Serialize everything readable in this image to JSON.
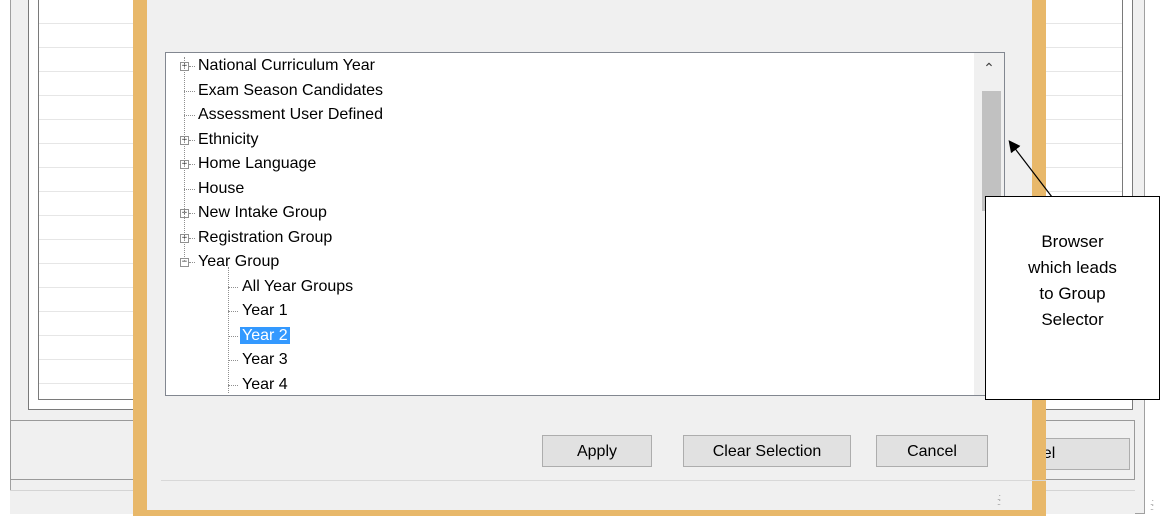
{
  "tree": {
    "nodes": [
      {
        "label": "National Curriculum Year",
        "expandable": true,
        "expanded": false,
        "level": 0
      },
      {
        "label": "Exam Season Candidates",
        "expandable": false,
        "level": 0
      },
      {
        "label": "Assessment User Defined",
        "expandable": false,
        "level": 0
      },
      {
        "label": "Ethnicity",
        "expandable": true,
        "expanded": false,
        "level": 0
      },
      {
        "label": "Home Language",
        "expandable": true,
        "expanded": false,
        "level": 0
      },
      {
        "label": "House",
        "expandable": false,
        "level": 0
      },
      {
        "label": "New Intake Group",
        "expandable": true,
        "expanded": false,
        "level": 0
      },
      {
        "label": "Registration Group",
        "expandable": true,
        "expanded": false,
        "level": 0
      },
      {
        "label": "Year Group",
        "expandable": true,
        "expanded": true,
        "level": 0
      },
      {
        "label": "All Year Groups",
        "expandable": false,
        "level": 1
      },
      {
        "label": "Year  1",
        "expandable": false,
        "level": 1
      },
      {
        "label": "Year  2",
        "expandable": false,
        "level": 1,
        "selected": true
      },
      {
        "label": "Year  3",
        "expandable": false,
        "level": 1
      },
      {
        "label": "Year  4",
        "expandable": false,
        "level": 1
      }
    ]
  },
  "buttons": {
    "apply": "Apply",
    "clear_selection": "Clear Selection",
    "cancel": "Cancel"
  },
  "background_window": {
    "cancel_partial": "ancel"
  },
  "annotation": {
    "lines": [
      "Browser",
      "which leads",
      "to Group",
      "Selector"
    ]
  },
  "icons": {
    "expand": "plus-box-icon",
    "collapse": "minus-box-icon",
    "scroll_up": "chevron-up-icon",
    "resize_grip": "resize-grip-icon"
  },
  "colors": {
    "dialog_border": "#e8b86a",
    "selection": "#3399ff"
  }
}
